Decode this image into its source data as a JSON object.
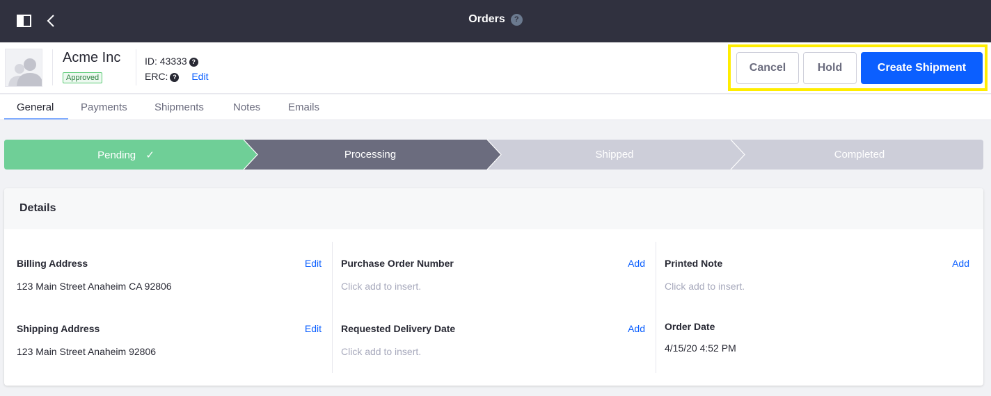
{
  "topbar": {
    "title": "Orders",
    "help_glyph": "?",
    "icons": [
      "sidebar-toggle-icon",
      "chevron-left-icon",
      "help-icon"
    ]
  },
  "header": {
    "account_name": "Acme Inc",
    "status_badge": "Approved",
    "id_label": "ID: 43333",
    "erc_label": "ERC:",
    "edit_link": "Edit",
    "help_glyph": "?",
    "buttons": {
      "cancel": "Cancel",
      "hold": "Hold",
      "create_shipment": "Create Shipment"
    }
  },
  "tabs": [
    {
      "label": "General",
      "active": true
    },
    {
      "label": "Payments",
      "active": false
    },
    {
      "label": "Shipments",
      "active": false
    },
    {
      "label": "Notes",
      "active": false
    },
    {
      "label": "Emails",
      "active": false
    }
  ],
  "progress": {
    "steps": [
      {
        "label": "Pending",
        "state": "completed",
        "check": "✓"
      },
      {
        "label": "Processing",
        "state": "active"
      },
      {
        "label": "Shipped",
        "state": "upcoming"
      },
      {
        "label": "Completed",
        "state": "upcoming"
      }
    ],
    "colors": {
      "completed": "#6fcf97",
      "active": "#6b6c7e",
      "upcoming": "#cdced9"
    }
  },
  "details": {
    "title": "Details",
    "columns": [
      [
        {
          "label": "Billing Address",
          "action": "Edit",
          "value": "123 Main Street Anaheim CA 92806",
          "placeholder": false
        },
        {
          "label": "Shipping Address",
          "action": "Edit",
          "value": "123 Main Street Anaheim 92806",
          "placeholder": false
        }
      ],
      [
        {
          "label": "Purchase Order Number",
          "action": "Add",
          "value": "Click add to insert.",
          "placeholder": true
        },
        {
          "label": "Requested Delivery Date",
          "action": "Add",
          "value": "Click add to insert.",
          "placeholder": true
        }
      ],
      [
        {
          "label": "Printed Note",
          "action": "Add",
          "value": "Click add to insert.",
          "placeholder": true
        },
        {
          "label": "Order Date",
          "action": "",
          "value": "4/15/20 4:52 PM",
          "placeholder": false
        }
      ]
    ]
  },
  "colors": {
    "brand_primary": "#0b5fff",
    "topbar_bg": "#30313f",
    "highlight": "#ffed00"
  }
}
